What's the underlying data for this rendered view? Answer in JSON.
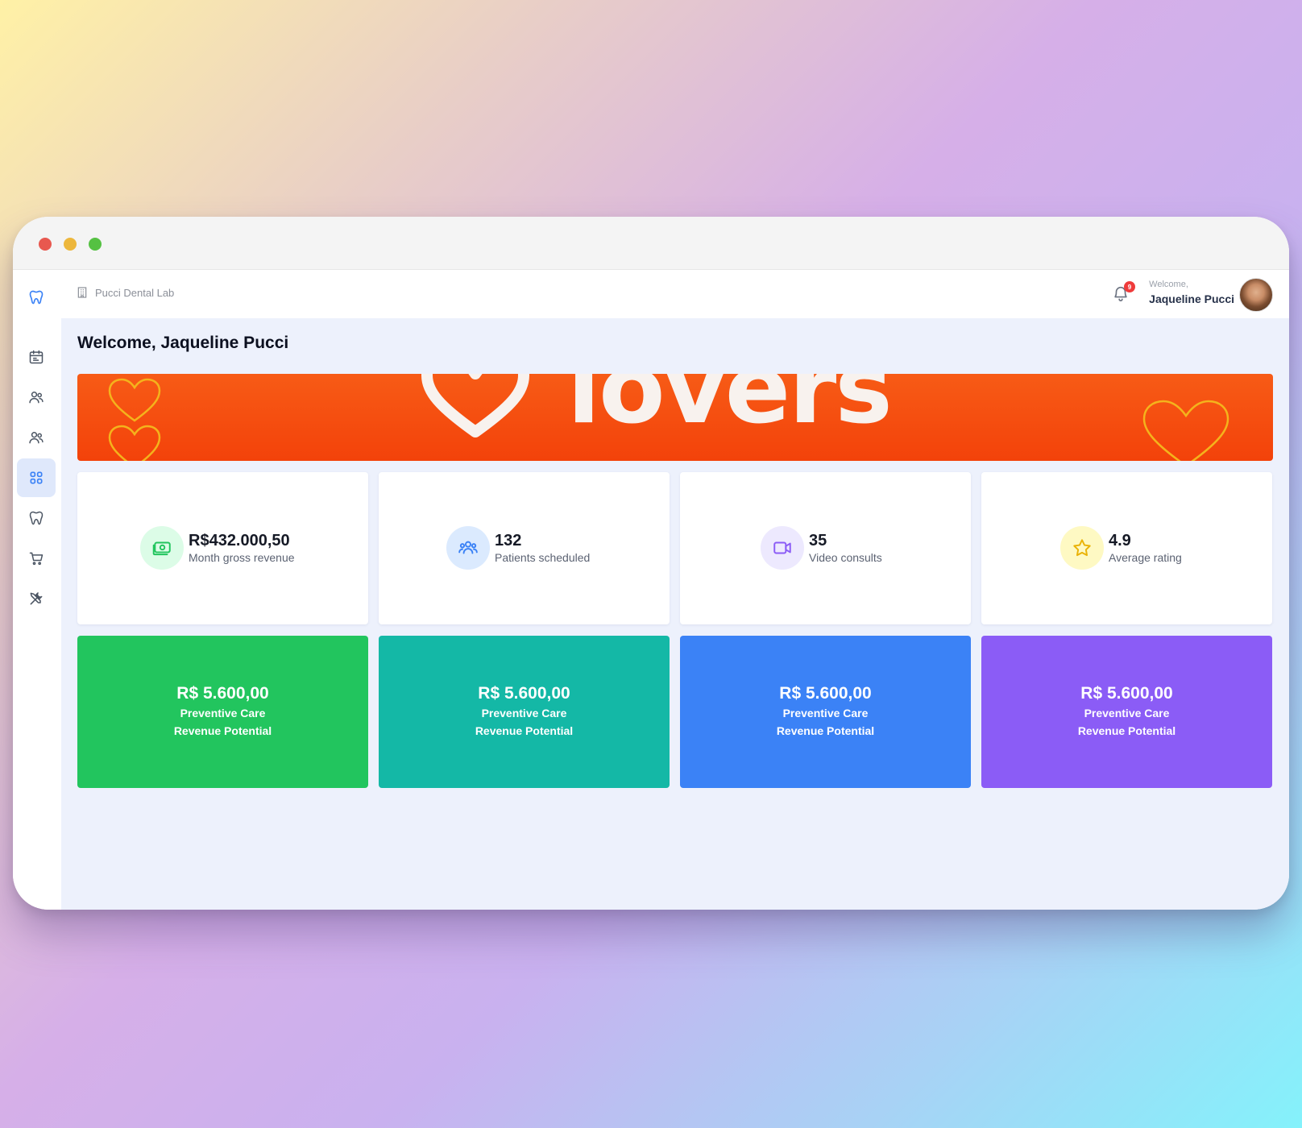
{
  "topbar": {
    "lab_name": "Pucci Dental Lab",
    "notification_count": "9",
    "welcome_prefix": "Welcome,",
    "user_name": "Jaqueline Pucci"
  },
  "sidebar": {
    "items": [
      {
        "icon": "tooth-icon"
      },
      {
        "icon": "calendar-icon"
      },
      {
        "icon": "users-icon"
      },
      {
        "icon": "users-icon"
      },
      {
        "icon": "grid-icon",
        "active": true
      },
      {
        "icon": "tooth-icon"
      },
      {
        "icon": "cart-icon"
      },
      {
        "icon": "tools-icon"
      }
    ]
  },
  "main": {
    "title": "Welcome, Jaqueline Pucci",
    "banner_text": "lovers"
  },
  "stats": [
    {
      "value": "R$432.000,50",
      "label": "Month gross revenue",
      "icon": "money-icon",
      "color": "#22c55e",
      "bg": "#dcfce7"
    },
    {
      "value": "132",
      "label": "Patients scheduled",
      "icon": "users-icon",
      "color": "#3b82f6",
      "bg": "#dbeafe"
    },
    {
      "value": "35",
      "label": "Video consults",
      "icon": "video-icon",
      "color": "#8b5cf6",
      "bg": "#ede9fe"
    },
    {
      "value": "4.9",
      "label": "Average rating",
      "icon": "star-icon",
      "color": "#eab308",
      "bg": "#fef9c3"
    }
  ],
  "revenue_cards": [
    {
      "value": "R$ 5.600,00",
      "line1": "Preventive Care",
      "line2": "Revenue Potential",
      "color": "#22c55e"
    },
    {
      "value": "R$ 5.600,00",
      "line1": "Preventive Care",
      "line2": "Revenue Potential",
      "color": "#14b8a6"
    },
    {
      "value": "R$ 5.600,00",
      "line1": "Preventive Care",
      "line2": "Revenue Potential",
      "color": "#3b82f6"
    },
    {
      "value": "R$ 5.600,00",
      "line1": "Preventive Care",
      "line2": "Revenue Potential",
      "color": "#8b5cf6"
    }
  ]
}
